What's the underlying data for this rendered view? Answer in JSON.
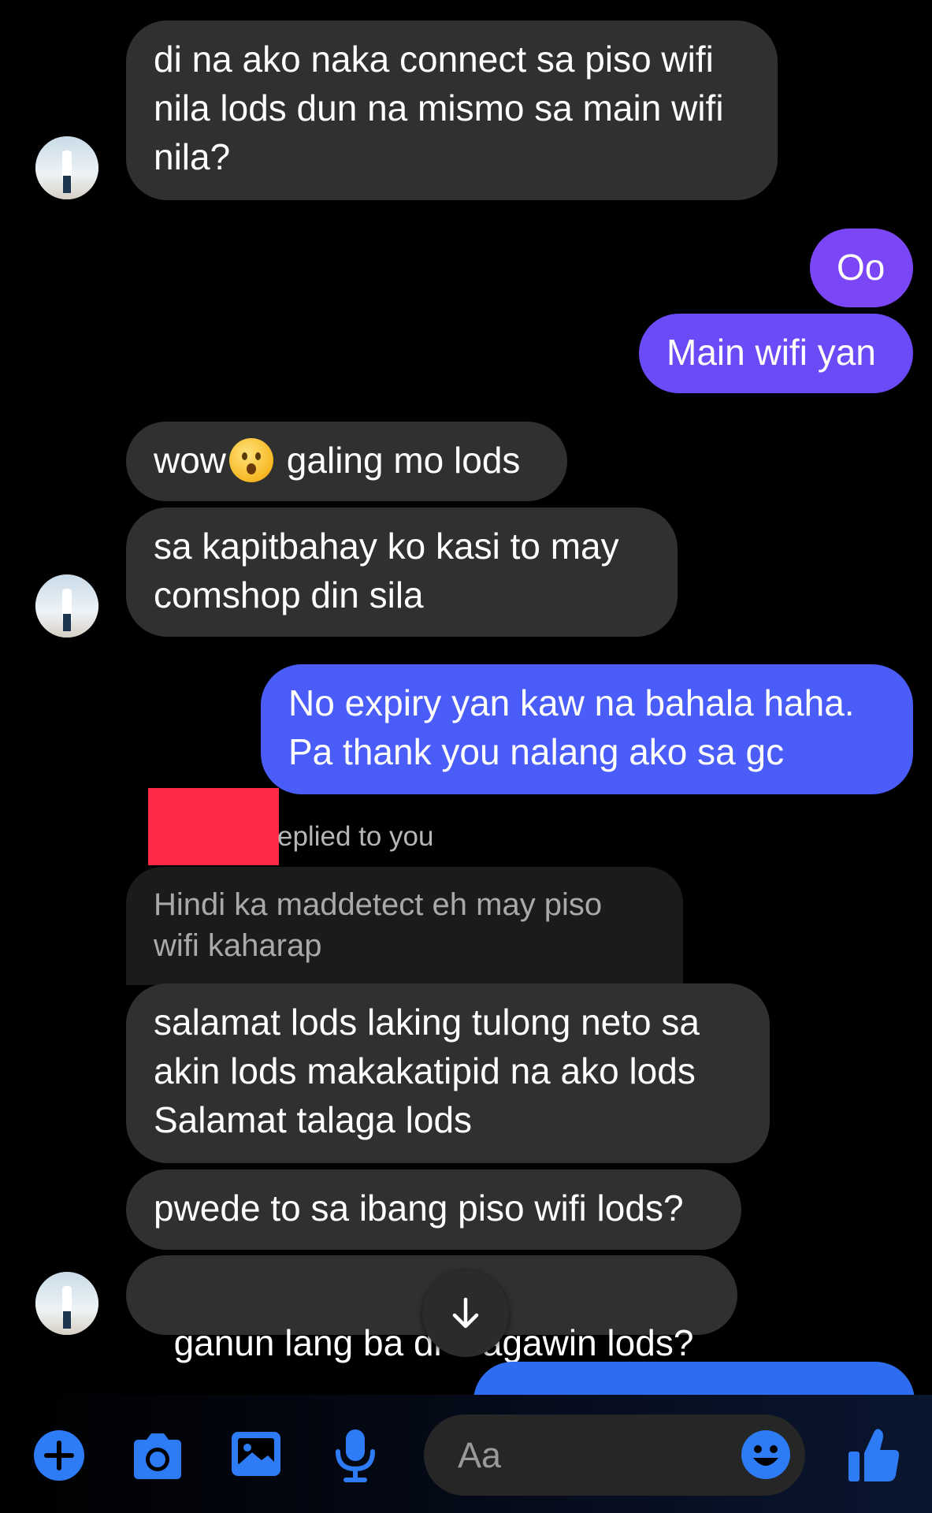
{
  "messages": {
    "m1": "di na ako naka connect sa piso wifi nila lods dun na mismo sa main wifi nila?",
    "m2": "Oo",
    "m3": "Main wifi yan",
    "m4_pre": "wow",
    "m4_post": " galing mo lods",
    "m5": "sa kapitbahay ko kasi to may comshop din sila",
    "m6": "No expiry yan kaw na bahala haha. Pa thank you nalang ako sa gc",
    "reply_label": "eplied to you",
    "reply_quote": "Hindi ka maddetect eh may piso wifi kaharap",
    "m7": "salamat lods laking tulong neto sa akin lods makakatipid na ako lods Salamat talaga lods",
    "m8": "pwede to sa ibang piso wifi lods?",
    "m9": "ganun lang ba di    agawin lods?"
  },
  "composer": {
    "placeholder": "Aa"
  },
  "colors": {
    "incoming": "#303030",
    "outgoing_purple": "#7b46f5",
    "outgoing_blue": "#4a5df8",
    "accent": "#2d7cf6"
  },
  "icons": [
    "plus-icon",
    "camera-icon",
    "image-icon",
    "microphone-icon",
    "emoji-icon",
    "thumbs-up-icon",
    "arrow-down-icon"
  ]
}
